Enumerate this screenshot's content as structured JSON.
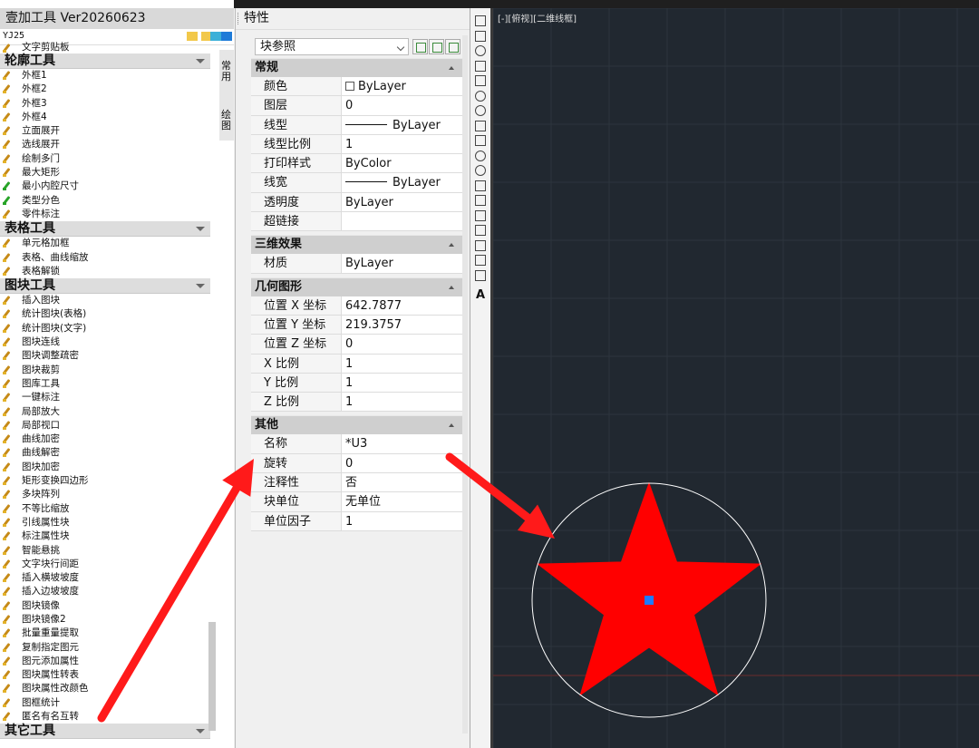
{
  "left_panel": {
    "title": "壹加工具 Ver20260623",
    "version_tag": "YJ25",
    "vertical_tabs": [
      "常用",
      "绘图"
    ],
    "partial_top_item": "文字剪贴板",
    "categories": [
      {
        "name": "轮廓工具",
        "items": [
          "外框1",
          "外框2",
          "外框3",
          "外框4",
          "立面展开",
          "选线展开",
          "绘制多门",
          "最大矩形",
          "最小内腔尺寸",
          "类型分色",
          "零件标注"
        ]
      },
      {
        "name": "表格工具",
        "items": [
          "单元格加框",
          "表格、曲线缩放",
          "表格解锁"
        ]
      },
      {
        "name": "图块工具",
        "items": [
          "插入图块",
          "统计图块(表格)",
          "统计图块(文字)",
          "图块连线",
          "图块调整疏密",
          "图块裁剪",
          "图库工具",
          "一键标注",
          "局部放大",
          "局部视口",
          "曲线加密",
          "曲线解密",
          "图块加密",
          "矩形变换四边形",
          "多块阵列",
          "不等比缩放",
          "引线属性块",
          "标注属性块",
          "智能悬挑",
          "文字块行间距",
          "插入横坡坡度",
          "插入边坡坡度",
          "图块镜像",
          "图块镜像2",
          "批量重量提取",
          "复制指定图元",
          "图元添加属性",
          "图块属性转表",
          "图块属性改颜色",
          "图框统计",
          "匿名有名互转"
        ]
      },
      {
        "name": "其它工具",
        "items": []
      }
    ],
    "green_icon_items": [
      "最小内腔尺寸",
      "类型分色"
    ]
  },
  "properties": {
    "title": "特性",
    "selected_type": "块参照",
    "sections": [
      {
        "name": "常规",
        "rows": [
          {
            "key": "颜色",
            "value": "ByLayer",
            "swatch": true
          },
          {
            "key": "图层",
            "value": "0"
          },
          {
            "key": "线型",
            "value": "ByLayer",
            "line": true
          },
          {
            "key": "线型比例",
            "value": "1"
          },
          {
            "key": "打印样式",
            "value": "ByColor"
          },
          {
            "key": "线宽",
            "value": "ByLayer",
            "line": true
          },
          {
            "key": "透明度",
            "value": "ByLayer"
          },
          {
            "key": "超链接",
            "value": ""
          }
        ]
      },
      {
        "name": "三维效果",
        "rows": [
          {
            "key": "材质",
            "value": "ByLayer"
          }
        ]
      },
      {
        "name": "几何图形",
        "rows": [
          {
            "key": "位置 X 坐标",
            "value": "642.7877"
          },
          {
            "key": "位置 Y 坐标",
            "value": "219.3757"
          },
          {
            "key": "位置 Z 坐标",
            "value": "0"
          },
          {
            "key": "X 比例",
            "value": "1"
          },
          {
            "key": "Y 比例",
            "value": "1"
          },
          {
            "key": "Z 比例",
            "value": "1"
          }
        ]
      },
      {
        "name": "其他",
        "rows": [
          {
            "key": "名称",
            "value": "*U3"
          },
          {
            "key": "旋转",
            "value": "0"
          },
          {
            "key": "注释性",
            "value": "否"
          },
          {
            "key": "块单位",
            "value": "无单位"
          },
          {
            "key": "单位因子",
            "value": "1"
          }
        ]
      }
    ]
  },
  "drawing_toolbar": {
    "text_tool_glyph": "A"
  },
  "canvas": {
    "view_label": "[-][俯视][二维线框]",
    "background_color": "#212830",
    "star_color": "#ff0000",
    "circle_color": "#ffffff",
    "grip_color": "#1e7bff",
    "arrow_color": "#ff1a1a"
  }
}
